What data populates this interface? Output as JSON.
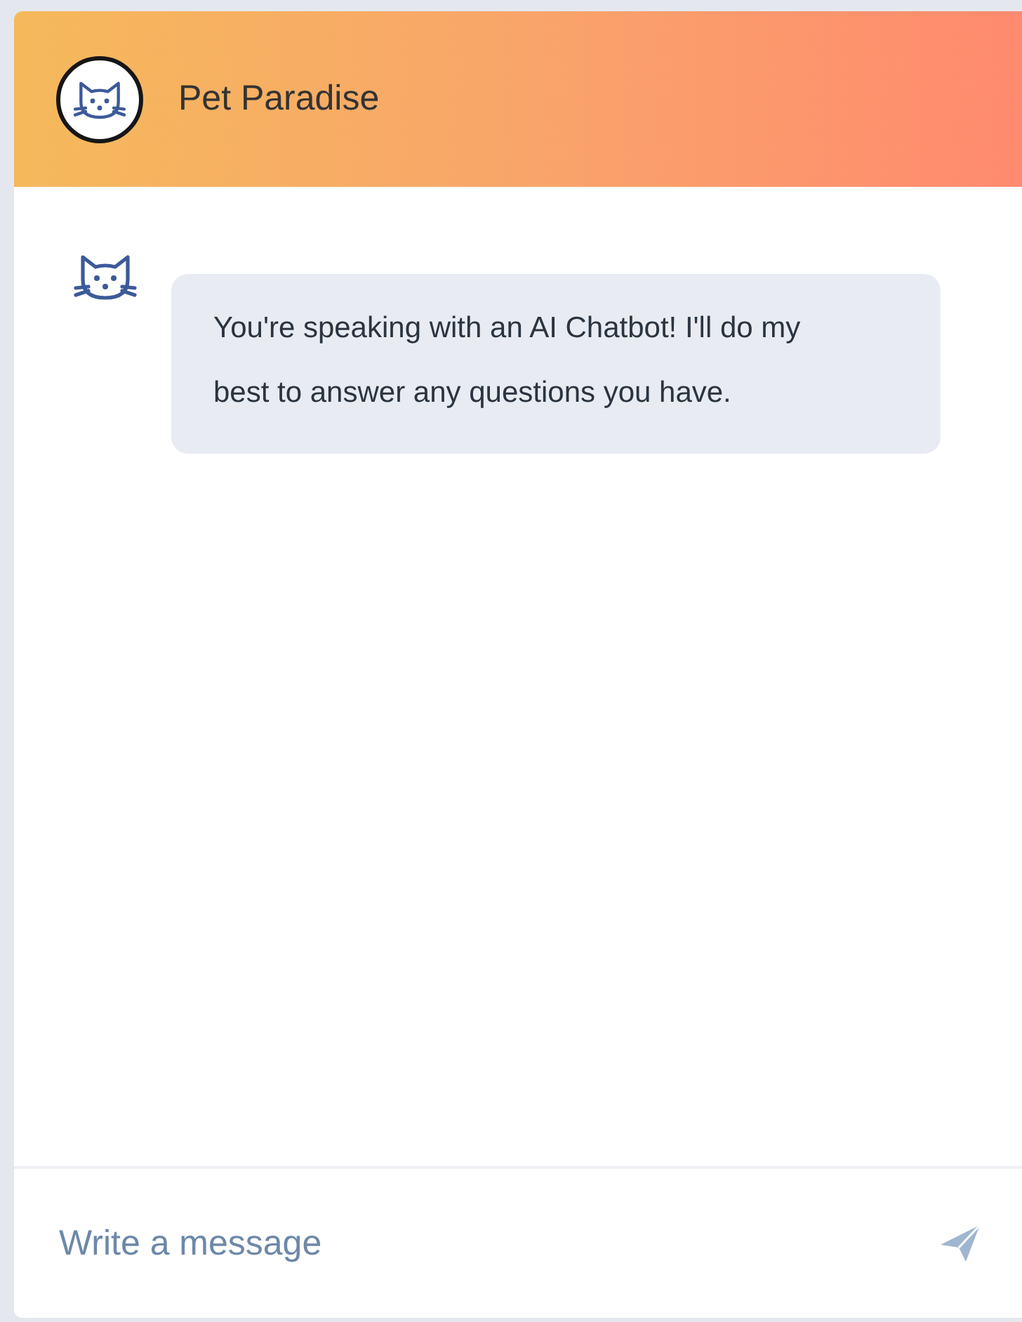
{
  "header": {
    "title": "Pet Paradise"
  },
  "messages": [
    {
      "kind": "bot",
      "text": "You're speaking with an AI Chatbot! I'll do my best to answer any questions you have."
    }
  ],
  "composer": {
    "placeholder": "Write a message"
  }
}
